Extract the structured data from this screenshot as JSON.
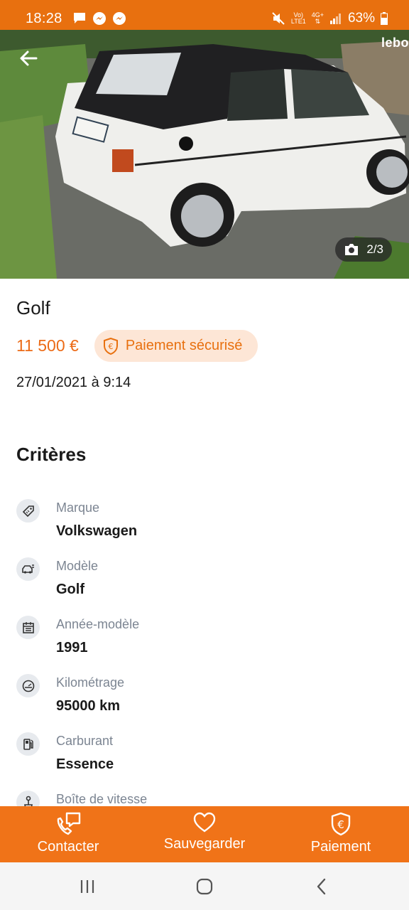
{
  "status_bar": {
    "time": "18:28",
    "net_top": "Vo)",
    "net_bottom": "LTE1",
    "gen_top": "4G+",
    "battery": "63%"
  },
  "listing": {
    "watermark": "lebo",
    "photo_counter": "2/3",
    "title": "Golf",
    "price": "11 500 €",
    "secure_payment_label": "Paiement sécurisé",
    "date": "27/01/2021 à 9:14"
  },
  "criteria": {
    "title": "Critères",
    "items": [
      {
        "label": "Marque",
        "value": "Volkswagen",
        "icon": "tag-icon"
      },
      {
        "label": "Modèle",
        "value": "Golf",
        "icon": "car-model-icon"
      },
      {
        "label": "Année-modèle",
        "value": "1991",
        "icon": "calendar-icon"
      },
      {
        "label": "Kilométrage",
        "value": "95000 km",
        "icon": "speedometer-icon"
      },
      {
        "label": "Carburant",
        "value": "Essence",
        "icon": "fuel-pump-icon"
      },
      {
        "label": "Boîte de vitesse",
        "value": "",
        "icon": "gear-shift-icon"
      }
    ]
  },
  "actions": {
    "contact": "Contacter",
    "save": "Sauvegarder",
    "payment": "Paiement"
  },
  "colors": {
    "brand_orange": "#f07318",
    "price_orange": "#ec6b17",
    "badge_bg": "#fde6d6"
  }
}
